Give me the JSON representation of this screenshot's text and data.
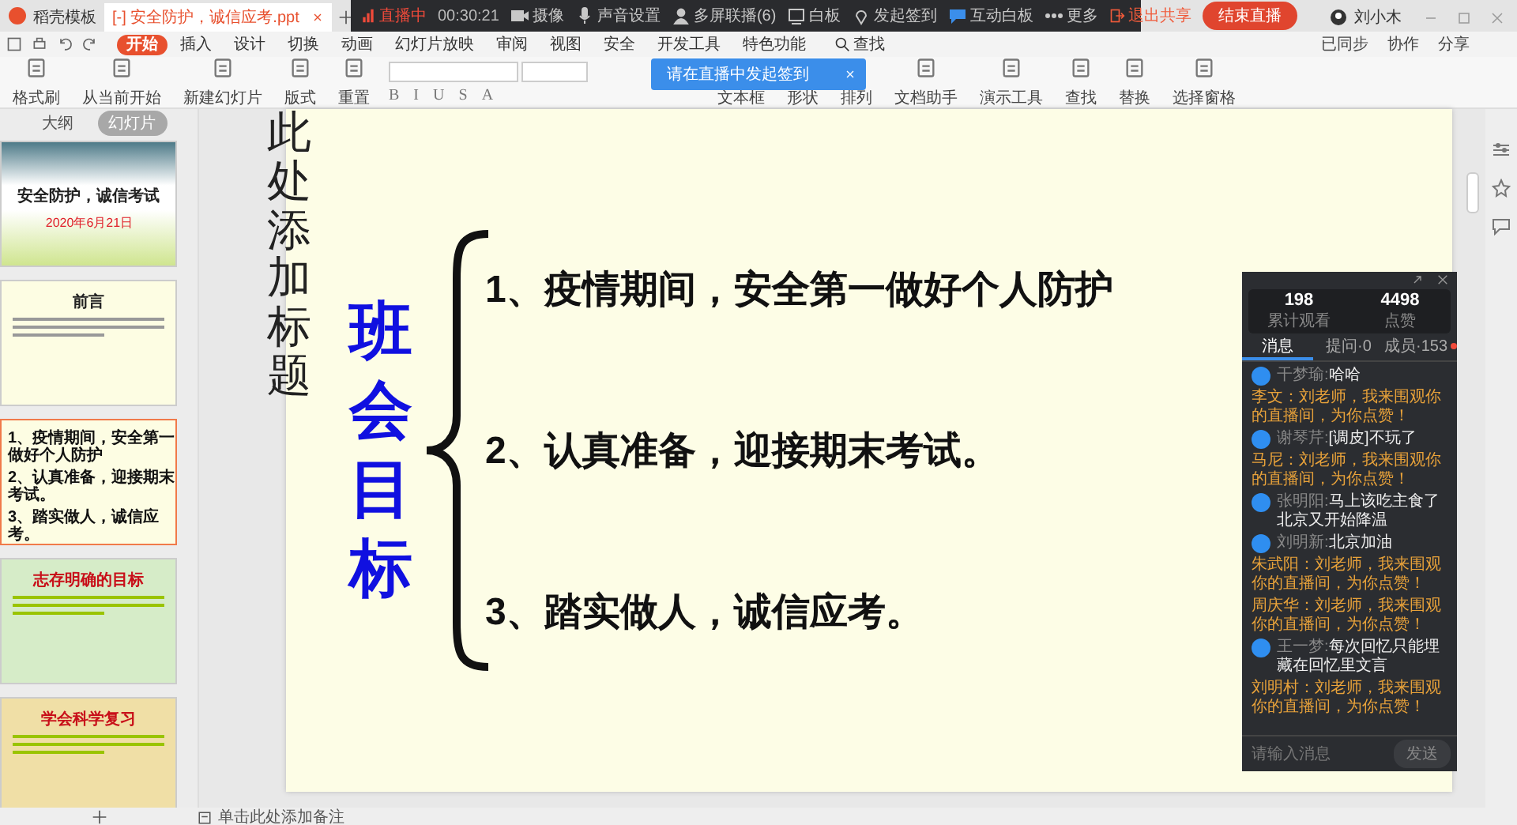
{
  "doc_tabs": [
    {
      "label": "稻壳模板",
      "kind": "home",
      "selected": false
    },
    {
      "label": "[-] 安全防护，诚信应考.ppt",
      "kind": "doc",
      "selected": true
    }
  ],
  "user": {
    "name": "刘小木"
  },
  "live_bar": {
    "status": "直播中",
    "time": "00:30:21",
    "items": [
      {
        "label": "摄像",
        "kind": "camera"
      },
      {
        "label": "声音设置",
        "kind": "mic"
      },
      {
        "label": "多屏联播(6)",
        "kind": "people"
      },
      {
        "label": "白板",
        "kind": "board"
      },
      {
        "label": "发起签到",
        "kind": "pin"
      },
      {
        "label": "互动白板",
        "kind": "chat"
      },
      {
        "label": "更多",
        "kind": "more"
      }
    ],
    "exit": "退出共享",
    "end": "结束直播"
  },
  "tooltip": "请在直播中发起签到",
  "menu": [
    {
      "label": "开始",
      "selected": true
    },
    {
      "label": "插入",
      "selected": false
    },
    {
      "label": "设计",
      "selected": false
    },
    {
      "label": "切换",
      "selected": false
    },
    {
      "label": "动画",
      "selected": false
    },
    {
      "label": "幻灯片放映",
      "selected": false
    },
    {
      "label": "审阅",
      "selected": false
    },
    {
      "label": "视图",
      "selected": false
    },
    {
      "label": "安全",
      "selected": false
    },
    {
      "label": "开发工具",
      "selected": false
    },
    {
      "label": "特色功能",
      "selected": false
    }
  ],
  "search_label": "查找",
  "top_right": [
    "已同步",
    "协作",
    "分享"
  ],
  "ribbon_left": [
    {
      "label": "格式刷"
    },
    {
      "label": "从当前开始"
    },
    {
      "label": "新建幻灯片"
    },
    {
      "label": "版式"
    },
    {
      "label": "重置"
    }
  ],
  "format_buttons": [
    "B",
    "I",
    "U",
    "S",
    "A"
  ],
  "ribbon_right": [
    {
      "label": "文本框"
    },
    {
      "label": "形状"
    },
    {
      "label": "排列"
    },
    {
      "label": "文档助手"
    },
    {
      "label": "演示工具"
    },
    {
      "label": "查找"
    },
    {
      "label": "替换"
    },
    {
      "label": "选择窗格"
    }
  ],
  "panel_tabs": [
    {
      "label": "大纲",
      "selected": false
    },
    {
      "label": "幻灯片",
      "selected": true
    }
  ],
  "thumbnails": [
    {
      "kind": "title",
      "title": "安全防护，诚信考试",
      "subtitle": "2020年6月21日",
      "selected": false
    },
    {
      "kind": "cream",
      "title": "前言",
      "selected": false
    },
    {
      "kind": "cream",
      "items": [
        "1、疫情期间，安全第一做好个人防护",
        "2、认真准备，迎接期末考试。",
        "3、踏实做人，诚信应考。"
      ],
      "selected": true
    },
    {
      "kind": "green",
      "title": "志存明确的目标",
      "selected": false
    },
    {
      "kind": "tan",
      "title": "学会科学复习",
      "selected": false
    }
  ],
  "slide": {
    "title": "此处添加标题",
    "heading": "班会目标",
    "items": [
      "1、疫情期间，安全第一做好个人防护",
      "2、认真准备，迎接期末考试。",
      "3、踏实做人，诚信应考。"
    ]
  },
  "live_panel": {
    "stats": [
      {
        "value": "198",
        "label": "累计观看"
      },
      {
        "value": "4498",
        "label": "点赞"
      }
    ],
    "tabs": [
      {
        "label": "消息",
        "selected": true,
        "dot": false
      },
      {
        "label": "提问·0",
        "selected": false,
        "dot": false
      },
      {
        "label": "成员·153",
        "selected": false,
        "dot": true
      }
    ],
    "messages": [
      {
        "kind": "user",
        "name": "干梦瑜:",
        "text": "哈哈"
      },
      {
        "kind": "system",
        "text": "李文：刘老师，我来围观你的直播间，为你点赞！"
      },
      {
        "kind": "user",
        "name": "谢琴芹:",
        "text": "[调皮]不玩了"
      },
      {
        "kind": "system",
        "text": "马尼：刘老师，我来围观你的直播间，为你点赞！"
      },
      {
        "kind": "user",
        "name": "张明阳:",
        "text": "马上该吃主食了北京又开始降温"
      },
      {
        "kind": "user",
        "name": "刘明新:",
        "text": "北京加油"
      },
      {
        "kind": "system",
        "text": "朱武阳：刘老师，我来围观你的直播间，为你点赞！"
      },
      {
        "kind": "system",
        "text": "周庆华：刘老师，我来围观你的直播间，为你点赞！"
      },
      {
        "kind": "user",
        "name": "王一梦:",
        "text": "每次回忆只能埋藏在回忆里文言"
      },
      {
        "kind": "system",
        "text": "刘明村：刘老师，我来围观你的直播间，为你点赞！"
      }
    ],
    "input_placeholder": "请输入消息",
    "send": "发送"
  },
  "notes_placeholder": "单击此处添加备注"
}
